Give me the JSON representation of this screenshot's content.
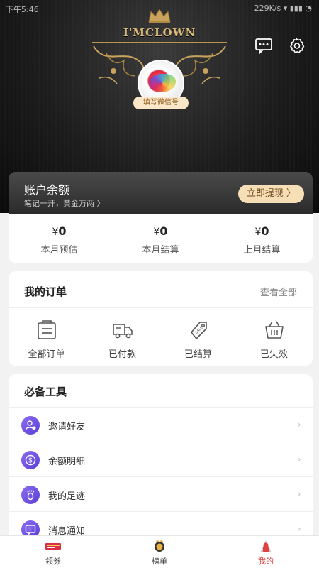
{
  "status_bar": {
    "time": "下午5:46",
    "right": "229K/s ▾ ▮▮▮ ◔"
  },
  "banner": {
    "title": "I'MCLOWN"
  },
  "profile": {
    "wechat_label": "填写微信号"
  },
  "top_icons": [
    "message-icon",
    "gear-icon"
  ],
  "balance": {
    "title": "账户余额",
    "subtitle": "笔记一开，黄金万两 〉",
    "withdraw_label": "立即提现 〉"
  },
  "stats": [
    {
      "currency": "¥",
      "value": "0",
      "label": "本月预估"
    },
    {
      "currency": "¥",
      "value": "0",
      "label": "本月结算"
    },
    {
      "currency": "¥",
      "value": "0",
      "label": "上月结算"
    }
  ],
  "orders": {
    "title": "我的订单",
    "view_all": "查看全部",
    "items": [
      {
        "label": "全部订单",
        "icon": "order-list-icon"
      },
      {
        "label": "已付款",
        "icon": "truck-icon"
      },
      {
        "label": "已结算",
        "icon": "tag-icon"
      },
      {
        "label": "已失效",
        "icon": "basket-icon"
      }
    ]
  },
  "tools": {
    "title": "必备工具",
    "items": [
      {
        "label": "邀请好友",
        "icon": "invite-icon"
      },
      {
        "label": "余额明细",
        "icon": "dollar-icon"
      },
      {
        "label": "我的足迹",
        "icon": "footprint-icon"
      },
      {
        "label": "消息通知",
        "icon": "notification-icon"
      }
    ]
  },
  "tabbar": [
    {
      "label": "领券",
      "icon": "coupon-icon",
      "active": false
    },
    {
      "label": "榜单",
      "icon": "ranking-icon",
      "active": false
    },
    {
      "label": "我的",
      "icon": "profile-icon",
      "active": true
    }
  ],
  "colors": {
    "accent_gold": "#f6dfb6",
    "tool_purple": "#6b4ad9",
    "active_tab": "#e04040"
  }
}
